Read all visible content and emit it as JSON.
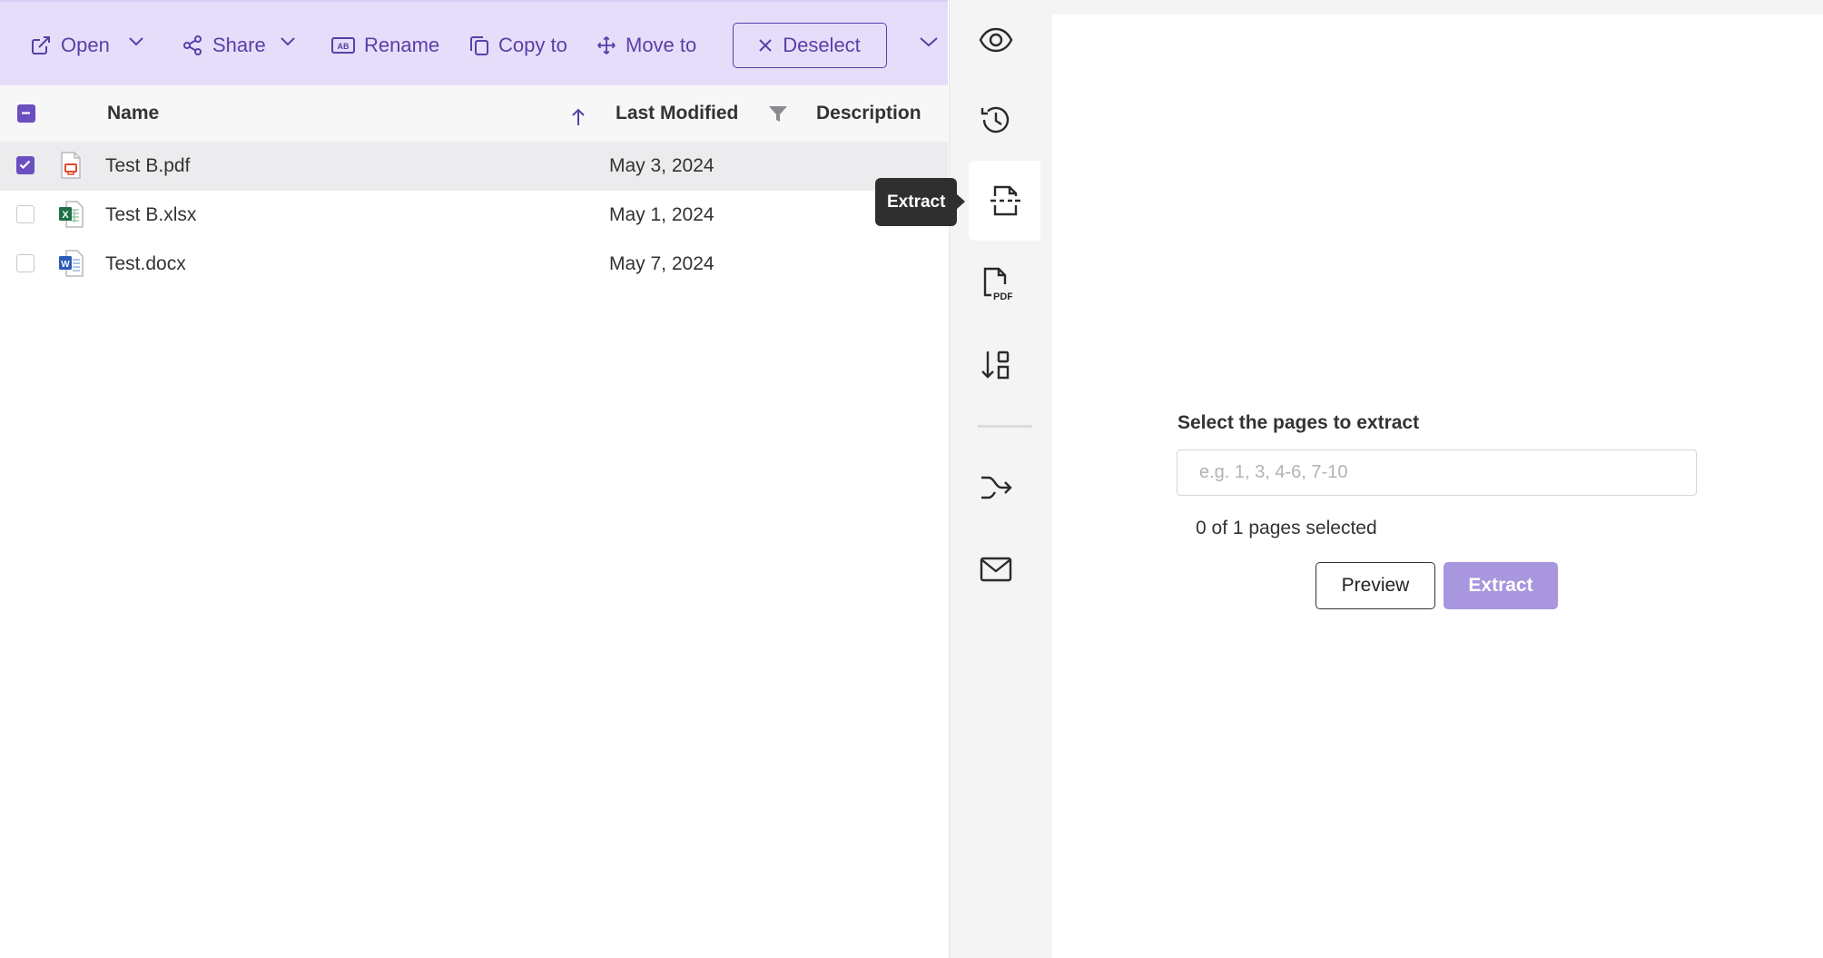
{
  "toolbar": {
    "open_label": "Open",
    "share_label": "Share",
    "rename_label": "Rename",
    "copy_label": "Copy to",
    "move_label": "Move to",
    "deselect_label": "Deselect"
  },
  "table": {
    "columns": {
      "name": "Name",
      "last_modified": "Last Modified",
      "description": "Description"
    },
    "rows": [
      {
        "name": "Test B.pdf",
        "modified": "May 3, 2024",
        "type": "pdf-file-icon",
        "selected": true
      },
      {
        "name": "Test B.xlsx",
        "modified": "May 1, 2024",
        "type": "excel-file-icon",
        "selected": false
      },
      {
        "name": "Test.docx",
        "modified": "May 7, 2024",
        "type": "word-file-icon",
        "selected": false
      }
    ]
  },
  "rail": {
    "tooltip": "Extract",
    "icons": [
      "eye-icon",
      "history-icon",
      "extract-icon",
      "pdf-convert-icon",
      "sort-shapes-icon",
      "merge-arrow-icon",
      "mail-icon"
    ]
  },
  "extract_panel": {
    "label": "Select the pages to extract",
    "input_placeholder": "e.g. 1, 3, 4-6, 7-10",
    "input_value": "",
    "selected_text": "0 of 1 pages selected",
    "preview_label": "Preview",
    "extract_label": "Extract"
  },
  "colors": {
    "accent": "#6b4fc1",
    "toolbar_bg": "#e6ddfa",
    "extract_button": "#a896de"
  }
}
